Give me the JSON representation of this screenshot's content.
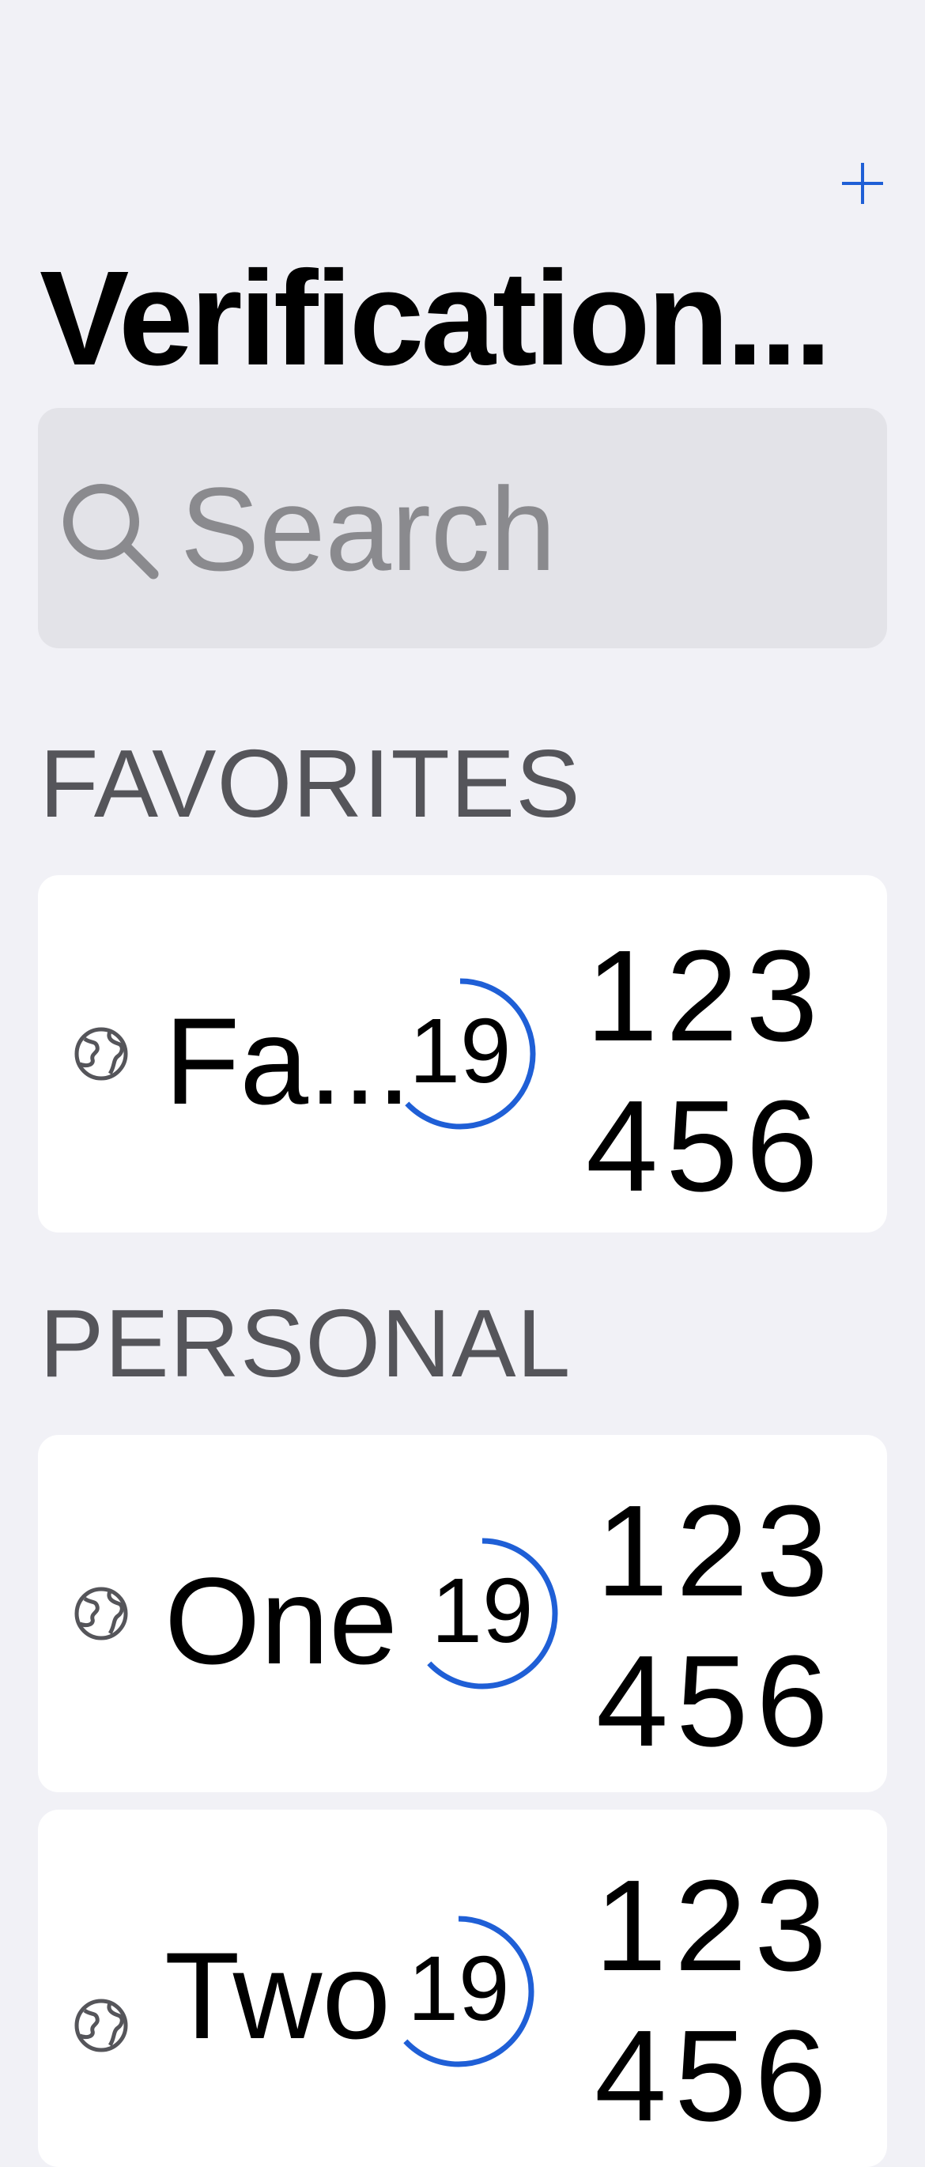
{
  "nav": {
    "add_icon": "plus-icon",
    "accent": "#1f5fd6"
  },
  "title": "Verification...",
  "search": {
    "placeholder": "Search",
    "icon": "search-icon"
  },
  "sections": [
    {
      "header": "FAVORITES",
      "items": [
        {
          "icon": "globe-icon",
          "name": "Fa...",
          "timer": "19",
          "timer_progress": 0.63,
          "code_top": "123",
          "code_bottom": "456"
        }
      ]
    },
    {
      "header": "PERSONAL",
      "items": [
        {
          "icon": "globe-icon",
          "name": "One",
          "timer": "19",
          "timer_progress": 0.63,
          "code_top": "123",
          "code_bottom": "456"
        },
        {
          "icon": "globe-icon",
          "name": "Two",
          "timer": "19",
          "timer_progress": 0.63,
          "code_top": "123",
          "code_bottom": "456"
        }
      ]
    }
  ]
}
